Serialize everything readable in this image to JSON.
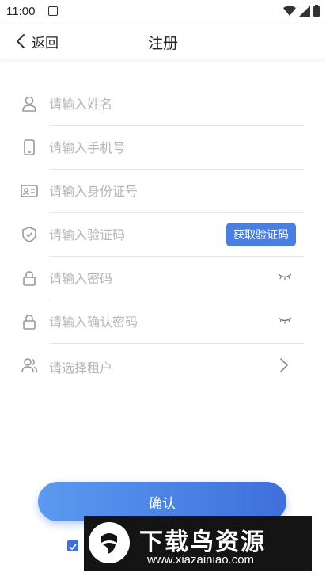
{
  "status_bar": {
    "time": "11:00"
  },
  "nav": {
    "back_label": "返回",
    "title": "注册"
  },
  "form": {
    "name_placeholder": "请输入姓名",
    "phone_placeholder": "请输入手机号",
    "id_placeholder": "请输入身份证号",
    "code_placeholder": "请输入验证码",
    "get_code_label": "获取验证码",
    "password_placeholder": "请输入密码",
    "confirm_password_placeholder": "请输入确认密码",
    "tenant_placeholder": "请选择租户"
  },
  "actions": {
    "confirm_label": "确认",
    "agree_checked": true
  },
  "watermark": {
    "title": "下载鸟资源",
    "url": "www.xiazainiao.com"
  },
  "colors": {
    "accent": "#4a7ee0",
    "button_gradient_start": "#5b9af0",
    "button_gradient_end": "#3f6fdc",
    "placeholder": "#b5b5b5"
  }
}
